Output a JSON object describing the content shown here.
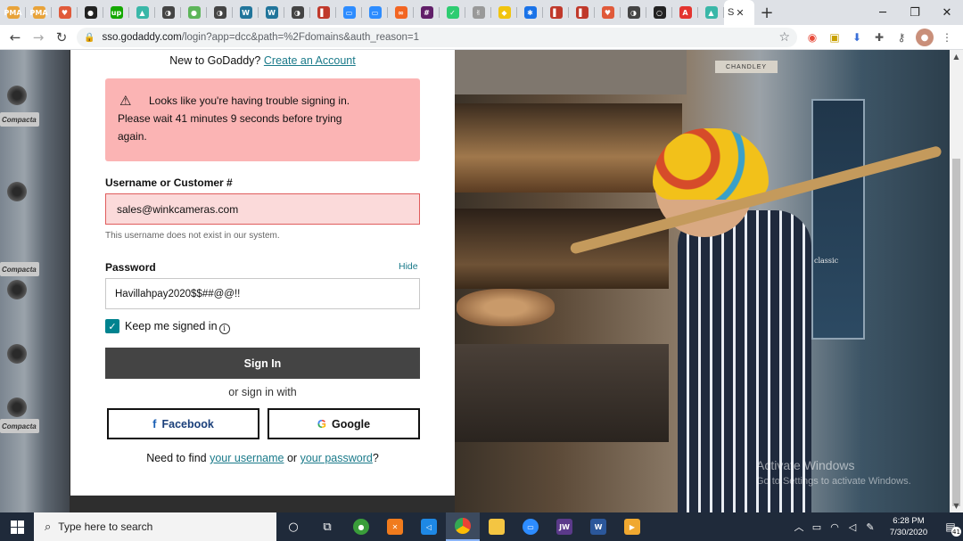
{
  "browser": {
    "active_tab_title": "S",
    "url_host": "sso.godaddy.com",
    "url_path": "/login?app=dcc&path=%2Fdomains&auth_reason=1",
    "tab_favicons": [
      {
        "name": "pma",
        "label": "PMA",
        "color": "#e8a33a"
      },
      {
        "name": "pma",
        "label": "PMA",
        "color": "#e8a33a"
      },
      {
        "name": "shield",
        "label": "♥",
        "color": "#e05a3a"
      },
      {
        "name": "github",
        "label": "●",
        "color": "#222222"
      },
      {
        "name": "upwork",
        "label": "up",
        "color": "#14a800"
      },
      {
        "name": "graduation",
        "label": "▲",
        "color": "#3ab7a8"
      },
      {
        "name": "site",
        "label": "◑",
        "color": "#444444"
      },
      {
        "name": "leaf",
        "label": "●",
        "color": "#5db55a"
      },
      {
        "name": "site",
        "label": "◑",
        "color": "#444444"
      },
      {
        "name": "wordpress",
        "label": "W",
        "color": "#21759b"
      },
      {
        "name": "wordpress",
        "label": "W",
        "color": "#21759b"
      },
      {
        "name": "site",
        "label": "◑",
        "color": "#444444"
      },
      {
        "name": "doc",
        "label": "▌",
        "color": "#c0392b"
      },
      {
        "name": "zoom",
        "label": "▭",
        "color": "#2d8cff"
      },
      {
        "name": "zoom",
        "label": "▭",
        "color": "#2d8cff"
      },
      {
        "name": "link",
        "label": "∞",
        "color": "#f26522"
      },
      {
        "name": "slack",
        "label": "#",
        "color": "#611f69"
      },
      {
        "name": "check",
        "label": "✓",
        "color": "#2ecc71"
      },
      {
        "name": "hands",
        "label": "✌",
        "color": "#999999"
      },
      {
        "name": "bulb",
        "label": "◆",
        "color": "#f1c40f"
      },
      {
        "name": "gear",
        "label": "✱",
        "color": "#1a73e8"
      },
      {
        "name": "doc",
        "label": "▌",
        "color": "#c0392b"
      },
      {
        "name": "doc",
        "label": "▌",
        "color": "#c0392b"
      },
      {
        "name": "shield",
        "label": "♥",
        "color": "#e05a3a"
      },
      {
        "name": "site",
        "label": "◑",
        "color": "#444444"
      },
      {
        "name": "circle",
        "label": "○",
        "color": "#222222"
      },
      {
        "name": "acrobat",
        "label": "A",
        "color": "#e3342f"
      },
      {
        "name": "graduation",
        "label": "▲",
        "color": "#3ab7a8"
      }
    ]
  },
  "login": {
    "new_prefix": "New to GoDaddy?",
    "create_account": "Create an Account",
    "alert_line1": "Looks like you're having trouble signing in.",
    "alert_line2": "Please wait 41 minutes 9 seconds before trying",
    "alert_line3": "again.",
    "username_label": "Username or Customer #",
    "username_value": "sales@winkcameras.com",
    "username_help": "This username does not exist in our system.",
    "password_label": "Password",
    "hide_label": "Hide",
    "password_value": "Havillahpay2020$$##@@!!",
    "keep_signed_in": "Keep me signed in",
    "signin_button": "Sign In",
    "or_sign_in_with": "or sign in with",
    "facebook_label": "Facebook",
    "google_label": "Google",
    "need_prefix": "Need to find",
    "your_username": "your username",
    "or_word": "or",
    "your_password": "your password",
    "question_mark": "?"
  },
  "background": {
    "oven_brand": "CHANDLEY",
    "oven_model": "classic",
    "badge_text": "Compacta"
  },
  "watermark": {
    "line1": "Activate Windows",
    "line2": "Go to Settings to activate Windows."
  },
  "taskbar": {
    "search_placeholder": "Type here to search",
    "time": "6:28 PM",
    "date": "7/30/2020",
    "notification_count": "41"
  }
}
